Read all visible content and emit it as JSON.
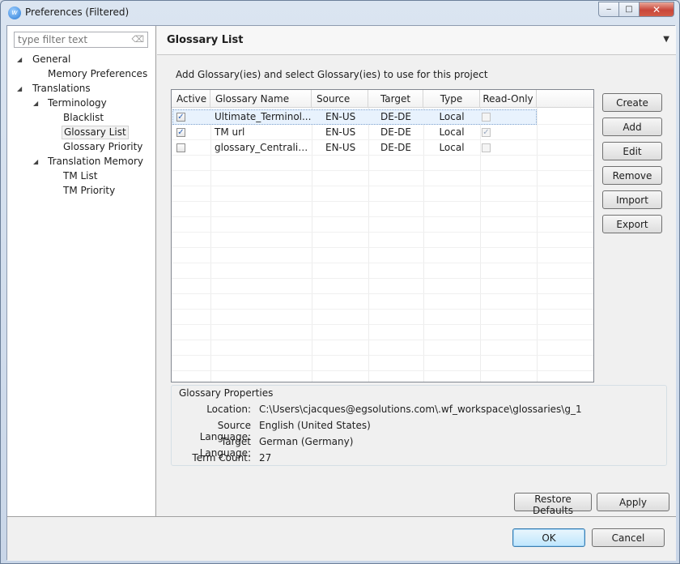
{
  "window": {
    "title": "Preferences (Filtered)",
    "controls": {
      "minimize": "‒",
      "maximize": "□",
      "close": "✕"
    }
  },
  "filter": {
    "placeholder": "type filter text"
  },
  "tree": [
    {
      "label": "General",
      "expanded": true
    },
    {
      "label": "Memory Preferences"
    },
    {
      "label": "Translations",
      "expanded": true
    },
    {
      "label": "Terminology",
      "expanded": true
    },
    {
      "label": "Blacklist"
    },
    {
      "label": "Glossary List",
      "selected": true
    },
    {
      "label": "Glossary Priority"
    },
    {
      "label": "Translation Memory",
      "expanded": true
    },
    {
      "label": "TM List"
    },
    {
      "label": "TM Priority"
    }
  ],
  "page": {
    "title": "Glossary List",
    "description": "Add Glossary(ies) and select Glossary(ies) to use for this project"
  },
  "table": {
    "columns": [
      "Active",
      "Glossary Name",
      "Source",
      "Target",
      "Type",
      "Read-Only"
    ],
    "rows": [
      {
        "active": true,
        "name": "Ultimate_Terminol...",
        "source": "EN-US",
        "target": "DE-DE",
        "type": "Local",
        "read_only": false,
        "selected": true
      },
      {
        "active": true,
        "name": "TM url",
        "source": "EN-US",
        "target": "DE-DE",
        "type": "Local",
        "read_only": true
      },
      {
        "active": false,
        "name": "glossary_Centraliza...",
        "source": "EN-US",
        "target": "DE-DE",
        "type": "Local",
        "read_only": false
      }
    ]
  },
  "side_buttons": {
    "create": "Create",
    "add": "Add",
    "edit": "Edit",
    "remove": "Remove",
    "import": "Import",
    "export": "Export"
  },
  "properties": {
    "legend": "Glossary Properties",
    "location_label": "Location:",
    "location_value": "C:\\Users\\cjacques@egsolutions.com\\.wf_workspace\\glossaries\\g_1",
    "source_label": "Source Language:",
    "source_value": "English (United States)",
    "target_label": "Target Language:",
    "target_value": "German (Germany)",
    "count_label": "Term Count:",
    "count_value": "27"
  },
  "buttons": {
    "restore_defaults": "Restore Defaults",
    "apply": "Apply",
    "ok": "OK",
    "cancel": "Cancel"
  },
  "colors": {
    "selection": "#e8f2fd",
    "check": "#2a62b8",
    "close_button": "#c9473a"
  }
}
